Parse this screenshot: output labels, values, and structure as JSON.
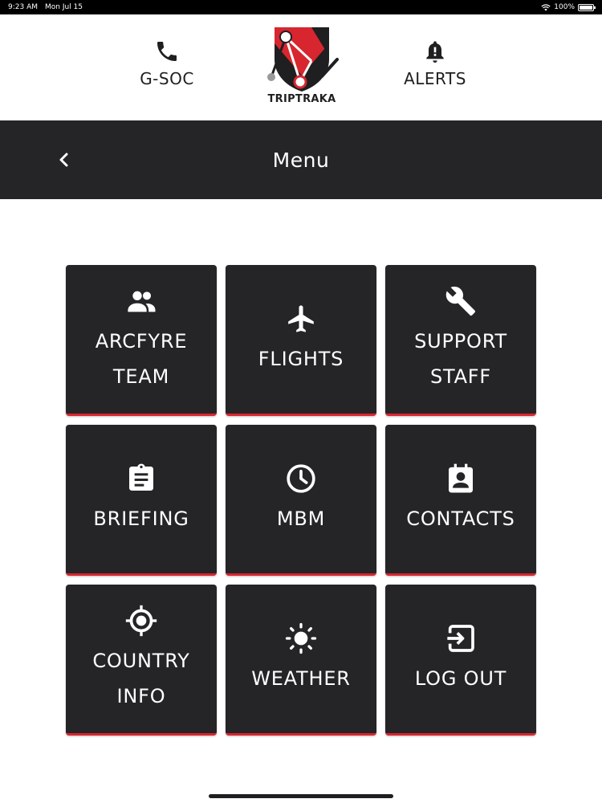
{
  "status_bar": {
    "time": "9:23 AM",
    "date": "Mon Jul 15",
    "battery": "100%",
    "battery_level": 1.0
  },
  "header": {
    "gsoc_label": "G-SOC",
    "gsoc_icon": "phone-icon",
    "alerts_label": "ALERTS",
    "alerts_icon": "bell-alert-icon",
    "logo_text": "TRIPTRAKA",
    "logo_colors": {
      "red": "#d7262f",
      "dark": "#1f1e20"
    }
  },
  "menu_bar": {
    "title": "Menu",
    "back_icon": "chevron-left-icon"
  },
  "tiles": [
    {
      "line1": "ARCFYRE",
      "line2": "TEAM",
      "icon": "people-icon"
    },
    {
      "line1": "FLIGHTS",
      "line2": "",
      "icon": "airplane-icon"
    },
    {
      "line1": "SUPPORT",
      "line2": "STAFF",
      "icon": "wrench-icon"
    },
    {
      "line1": "BRIEFING",
      "line2": "",
      "icon": "clipboard-icon"
    },
    {
      "line1": "MBM",
      "line2": "",
      "icon": "clock-icon"
    },
    {
      "line1": "CONTACTS",
      "line2": "",
      "icon": "contact-card-icon"
    },
    {
      "line1": "COUNTRY",
      "line2": "INFO",
      "icon": "crosshair-icon"
    },
    {
      "line1": "WEATHER",
      "line2": "",
      "icon": "sun-icon"
    },
    {
      "line1": "LOG OUT",
      "line2": "",
      "icon": "logout-icon"
    }
  ],
  "colors": {
    "bar_background": "#252427",
    "tile_background": "#252427",
    "accent": "#d7262f",
    "text_light": "#ffffff"
  }
}
